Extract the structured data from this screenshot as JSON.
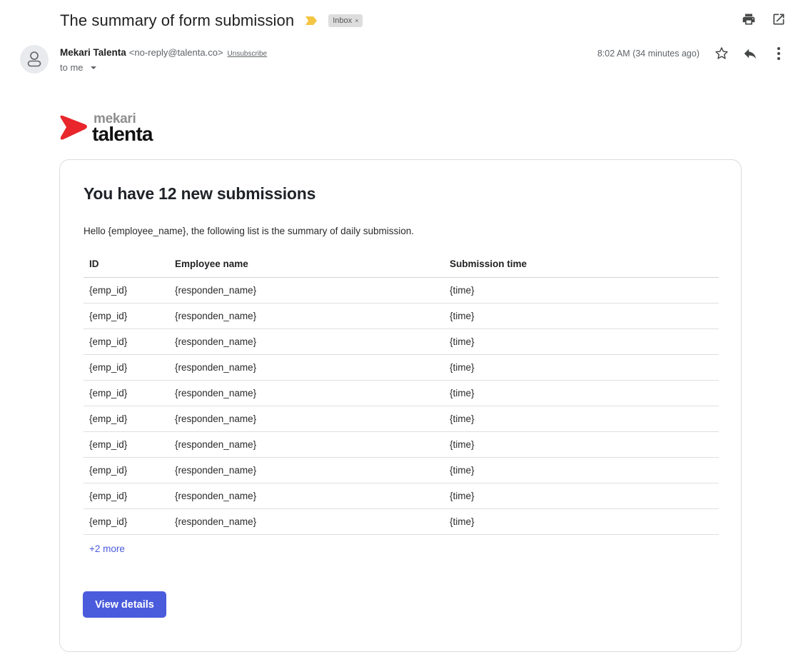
{
  "email": {
    "subject": "The summary of form submission",
    "label": "Inbox",
    "label_remove": "×",
    "sender_name": "Mekari Talenta",
    "sender_email": "<no-reply@talenta.co>",
    "unsubscribe": "Unsubscribe",
    "recipient": "to me",
    "timestamp": "8:02 AM (34 minutes ago)"
  },
  "icons": {
    "importance": "importance-marker-icon",
    "print": "print-icon",
    "open_new": "open-in-new-window-icon",
    "avatar": "person-icon",
    "star": "star-icon",
    "reply": "reply-icon",
    "more": "more-vertical-icon"
  },
  "logo": {
    "top": "mekari",
    "bottom": "talenta",
    "mark_color": "#e8262b"
  },
  "body": {
    "title": "You have 12 new submissions",
    "intro": "Hello {employee_name}, the following list is the summary of daily submission.",
    "columns": [
      "ID",
      "Employee name",
      "Submission time"
    ],
    "rows": [
      [
        "{emp_id}",
        "{responden_name}",
        "{time}"
      ],
      [
        "{emp_id}",
        "{responden_name}",
        "{time}"
      ],
      [
        "{emp_id}",
        "{responden_name}",
        "{time}"
      ],
      [
        "{emp_id}",
        "{responden_name}",
        "{time}"
      ],
      [
        "{emp_id}",
        "{responden_name}",
        "{time}"
      ],
      [
        "{emp_id}",
        "{responden_name}",
        "{time}"
      ],
      [
        "{emp_id}",
        "{responden_name}",
        "{time}"
      ],
      [
        "{emp_id}",
        "{responden_name}",
        "{time}"
      ],
      [
        "{emp_id}",
        "{responden_name}",
        "{time}"
      ],
      [
        "{emp_id}",
        "{responden_name}",
        "{time}"
      ]
    ],
    "more_link": "+2 more",
    "button": "View details"
  },
  "colors": {
    "accent": "#4a5bdc",
    "importance": "#f4c542"
  }
}
